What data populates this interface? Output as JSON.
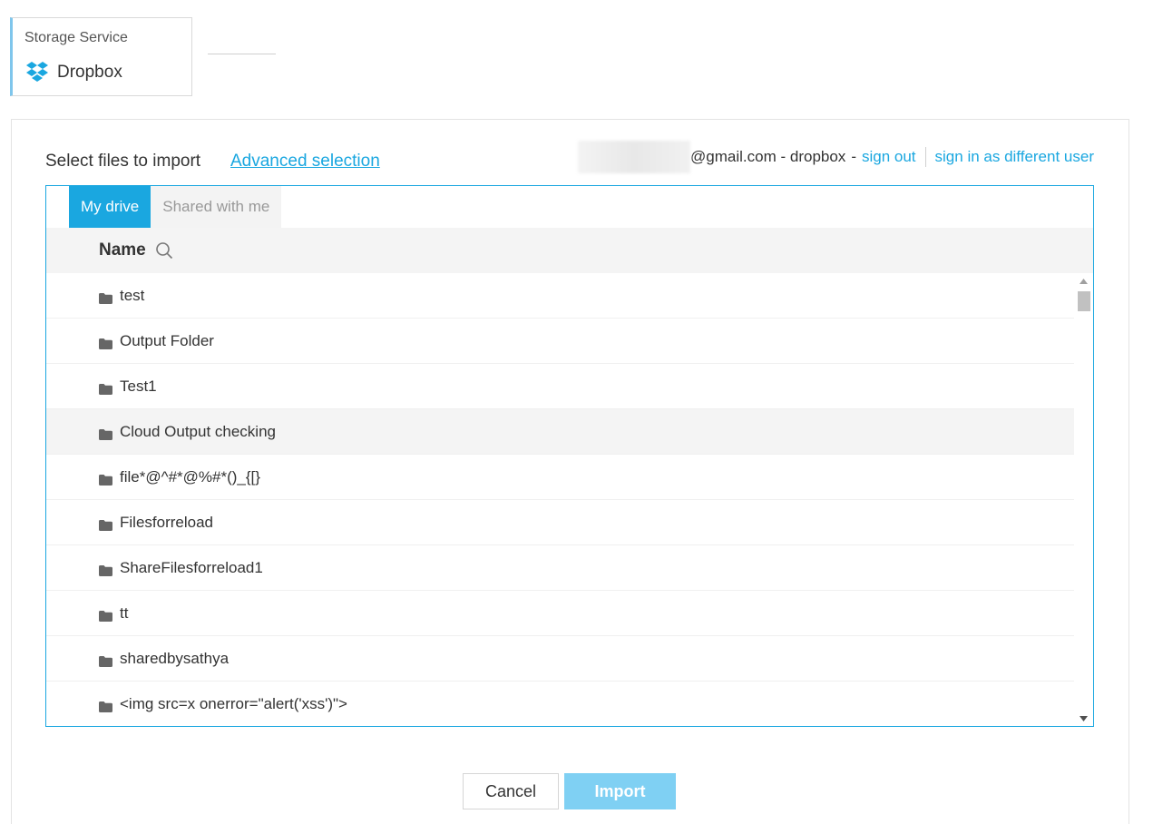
{
  "storage": {
    "label": "Storage Service",
    "value": "Dropbox",
    "icon": "dropbox-icon"
  },
  "header": {
    "select_label": "Select files to import",
    "advanced_link": "Advanced selection"
  },
  "account": {
    "email_domain": "@gmail.com - dropbox",
    "dash": "-",
    "sign_out": "sign out",
    "sign_in_different": "sign in as different user"
  },
  "tabs": [
    {
      "label": "My drive",
      "active": true
    },
    {
      "label": "Shared with me",
      "active": false
    }
  ],
  "table": {
    "name_header": "Name",
    "rows": [
      {
        "name": "test"
      },
      {
        "name": "Output Folder"
      },
      {
        "name": "Test1"
      },
      {
        "name": "Cloud Output checking"
      },
      {
        "name": "file*@^#*@%#*()_{[}"
      },
      {
        "name": "Filesforreload"
      },
      {
        "name": "ShareFilesforreload1"
      },
      {
        "name": "tt"
      },
      {
        "name": "sharedbysathya"
      },
      {
        "name": "<img src=x onerror=\"alert('xss')\">"
      }
    ]
  },
  "buttons": {
    "cancel": "Cancel",
    "import": "Import"
  },
  "colors": {
    "accent": "#1aa7e0",
    "import_disabled": "#7fd0f3"
  }
}
